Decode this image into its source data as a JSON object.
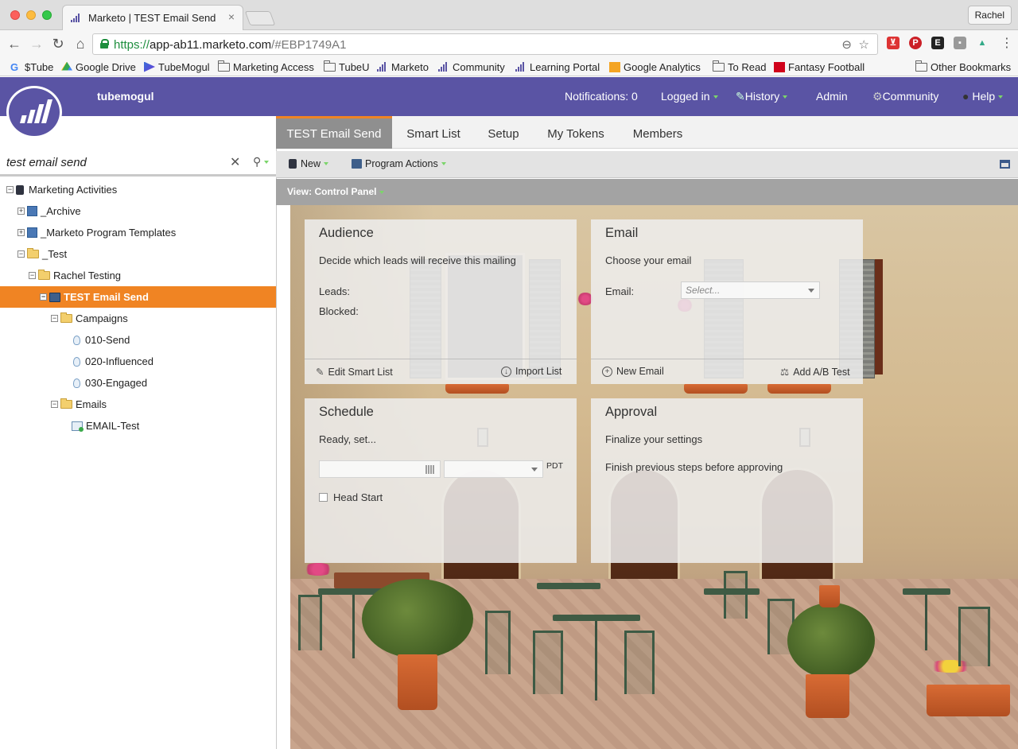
{
  "browser": {
    "tab_title": "Marketo | TEST Email Send",
    "tab_close": "×",
    "profile_name": "Rachel",
    "url_scheme": "https://",
    "url_host": "app-ab11.marketo.com",
    "url_rest": "/#EBP1749A1",
    "bookmarks": [
      "$Tube",
      "Google Drive",
      "TubeMogul",
      "Marketing Access",
      "TubeU",
      "Marketo",
      "Community",
      "Learning Portal",
      "Google Analytics",
      "To Read",
      "Fantasy Football"
    ],
    "other_bookmarks": "Other Bookmarks"
  },
  "header": {
    "brand": "tubemogul",
    "notifications": "Notifications: 0",
    "logged_in": "Logged in",
    "history": "History",
    "admin": "Admin",
    "community": "Community",
    "help": "Help"
  },
  "left": {
    "search_value": "test email send",
    "clear": "✕"
  },
  "tree": {
    "root": "Marketing Activities",
    "archive": "_Archive",
    "templates": "_Marketo Program Templates",
    "test": "_Test",
    "rachel": "Rachel Testing",
    "program": "TEST Email Send",
    "campaigns": "Campaigns",
    "c1": "010-Send",
    "c2": "020-Influenced",
    "c3": "030-Engaged",
    "emails": "Emails",
    "e1": "EMAIL-Test"
  },
  "tabs": [
    "TEST Email Send",
    "Smart List",
    "Setup",
    "My Tokens",
    "Members"
  ],
  "toolbar": {
    "new_label": "New",
    "program_actions": "Program Actions"
  },
  "view_label": "View: Control Panel",
  "audience": {
    "title": "Audience",
    "desc": "Decide which leads will receive this mailing",
    "leads_label": "Leads:",
    "blocked_label": "Blocked:",
    "edit_smart_list": "Edit Smart List",
    "import_list": "Import List"
  },
  "email": {
    "title": "Email",
    "desc": "Choose your email",
    "email_label": "Email:",
    "select_placeholder": "Select...",
    "new_email": "New Email",
    "add_ab_test": "Add A/B Test"
  },
  "schedule": {
    "title": "Schedule",
    "desc": "Ready, set...",
    "timezone": "PDT",
    "head_start": "Head Start"
  },
  "approval": {
    "title": "Approval",
    "desc": "Finalize your settings",
    "note": "Finish previous steps before approving"
  },
  "colors": {
    "marketo_purple": "#5a54a4",
    "orange_accent": "#f08423"
  }
}
